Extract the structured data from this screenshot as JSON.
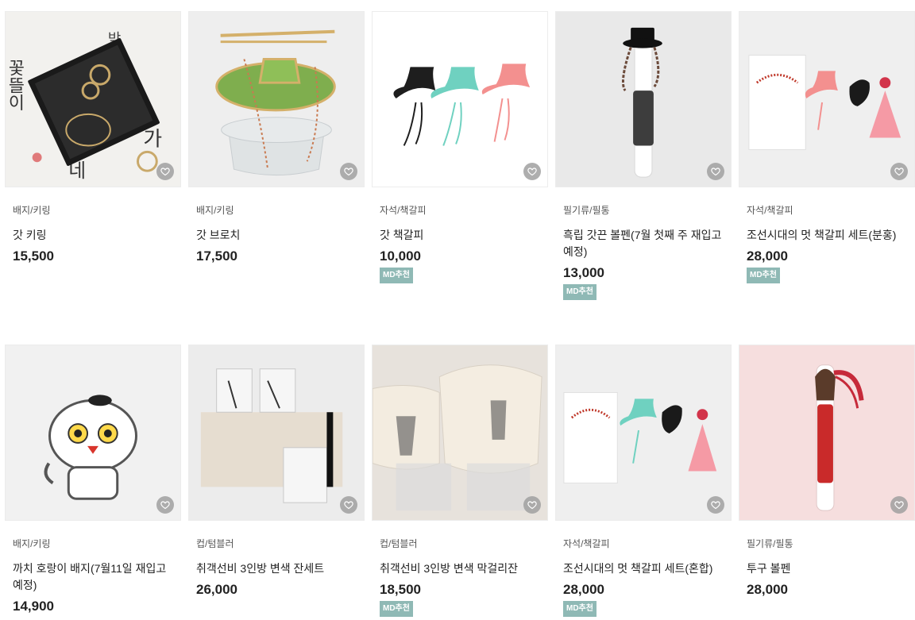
{
  "products": [
    {
      "category": "배지/키링",
      "name": "갓 키링",
      "price": "15,500",
      "badge": ""
    },
    {
      "category": "배지/키링",
      "name": "갓 브로치",
      "price": "17,500",
      "badge": ""
    },
    {
      "category": "자석/책갈피",
      "name": "갓 책갈피",
      "price": "10,000",
      "badge": "MD추천"
    },
    {
      "category": "필기류/필통",
      "name": "흑립 갓끈 볼펜(7월 첫째 주 재입고 예정)",
      "price": "13,000",
      "badge": "MD추천"
    },
    {
      "category": "자석/책갈피",
      "name": "조선시대의 멋 책갈피 세트(분홍)",
      "price": "28,000",
      "badge": "MD추천"
    },
    {
      "category": "배지/키링",
      "name": "까치 호랑이 배지(7월11일 재입고 예정)",
      "price": "14,900",
      "badge": ""
    },
    {
      "category": "컵/텀블러",
      "name": "취객선비 3인방 변색 잔세트",
      "price": "26,000",
      "badge": ""
    },
    {
      "category": "컵/텀블러",
      "name": "취객선비 3인방 변색 막걸리잔",
      "price": "18,500",
      "badge": "MD추천"
    },
    {
      "category": "자석/책갈피",
      "name": "조선시대의 멋 책갈피 세트(혼합)",
      "price": "28,000",
      "badge": "MD추천"
    },
    {
      "category": "필기류/필통",
      "name": "투구 볼펜",
      "price": "28,000",
      "badge": ""
    }
  ],
  "image_text": {
    "calligraphy": [
      "박",
      "꽃뜰이",
      "가",
      "네"
    ]
  },
  "colors": {
    "badge": "#8fb9b5",
    "heart_bg": "#a0a0a0"
  },
  "icons": {
    "wishlist": "heart-icon"
  }
}
